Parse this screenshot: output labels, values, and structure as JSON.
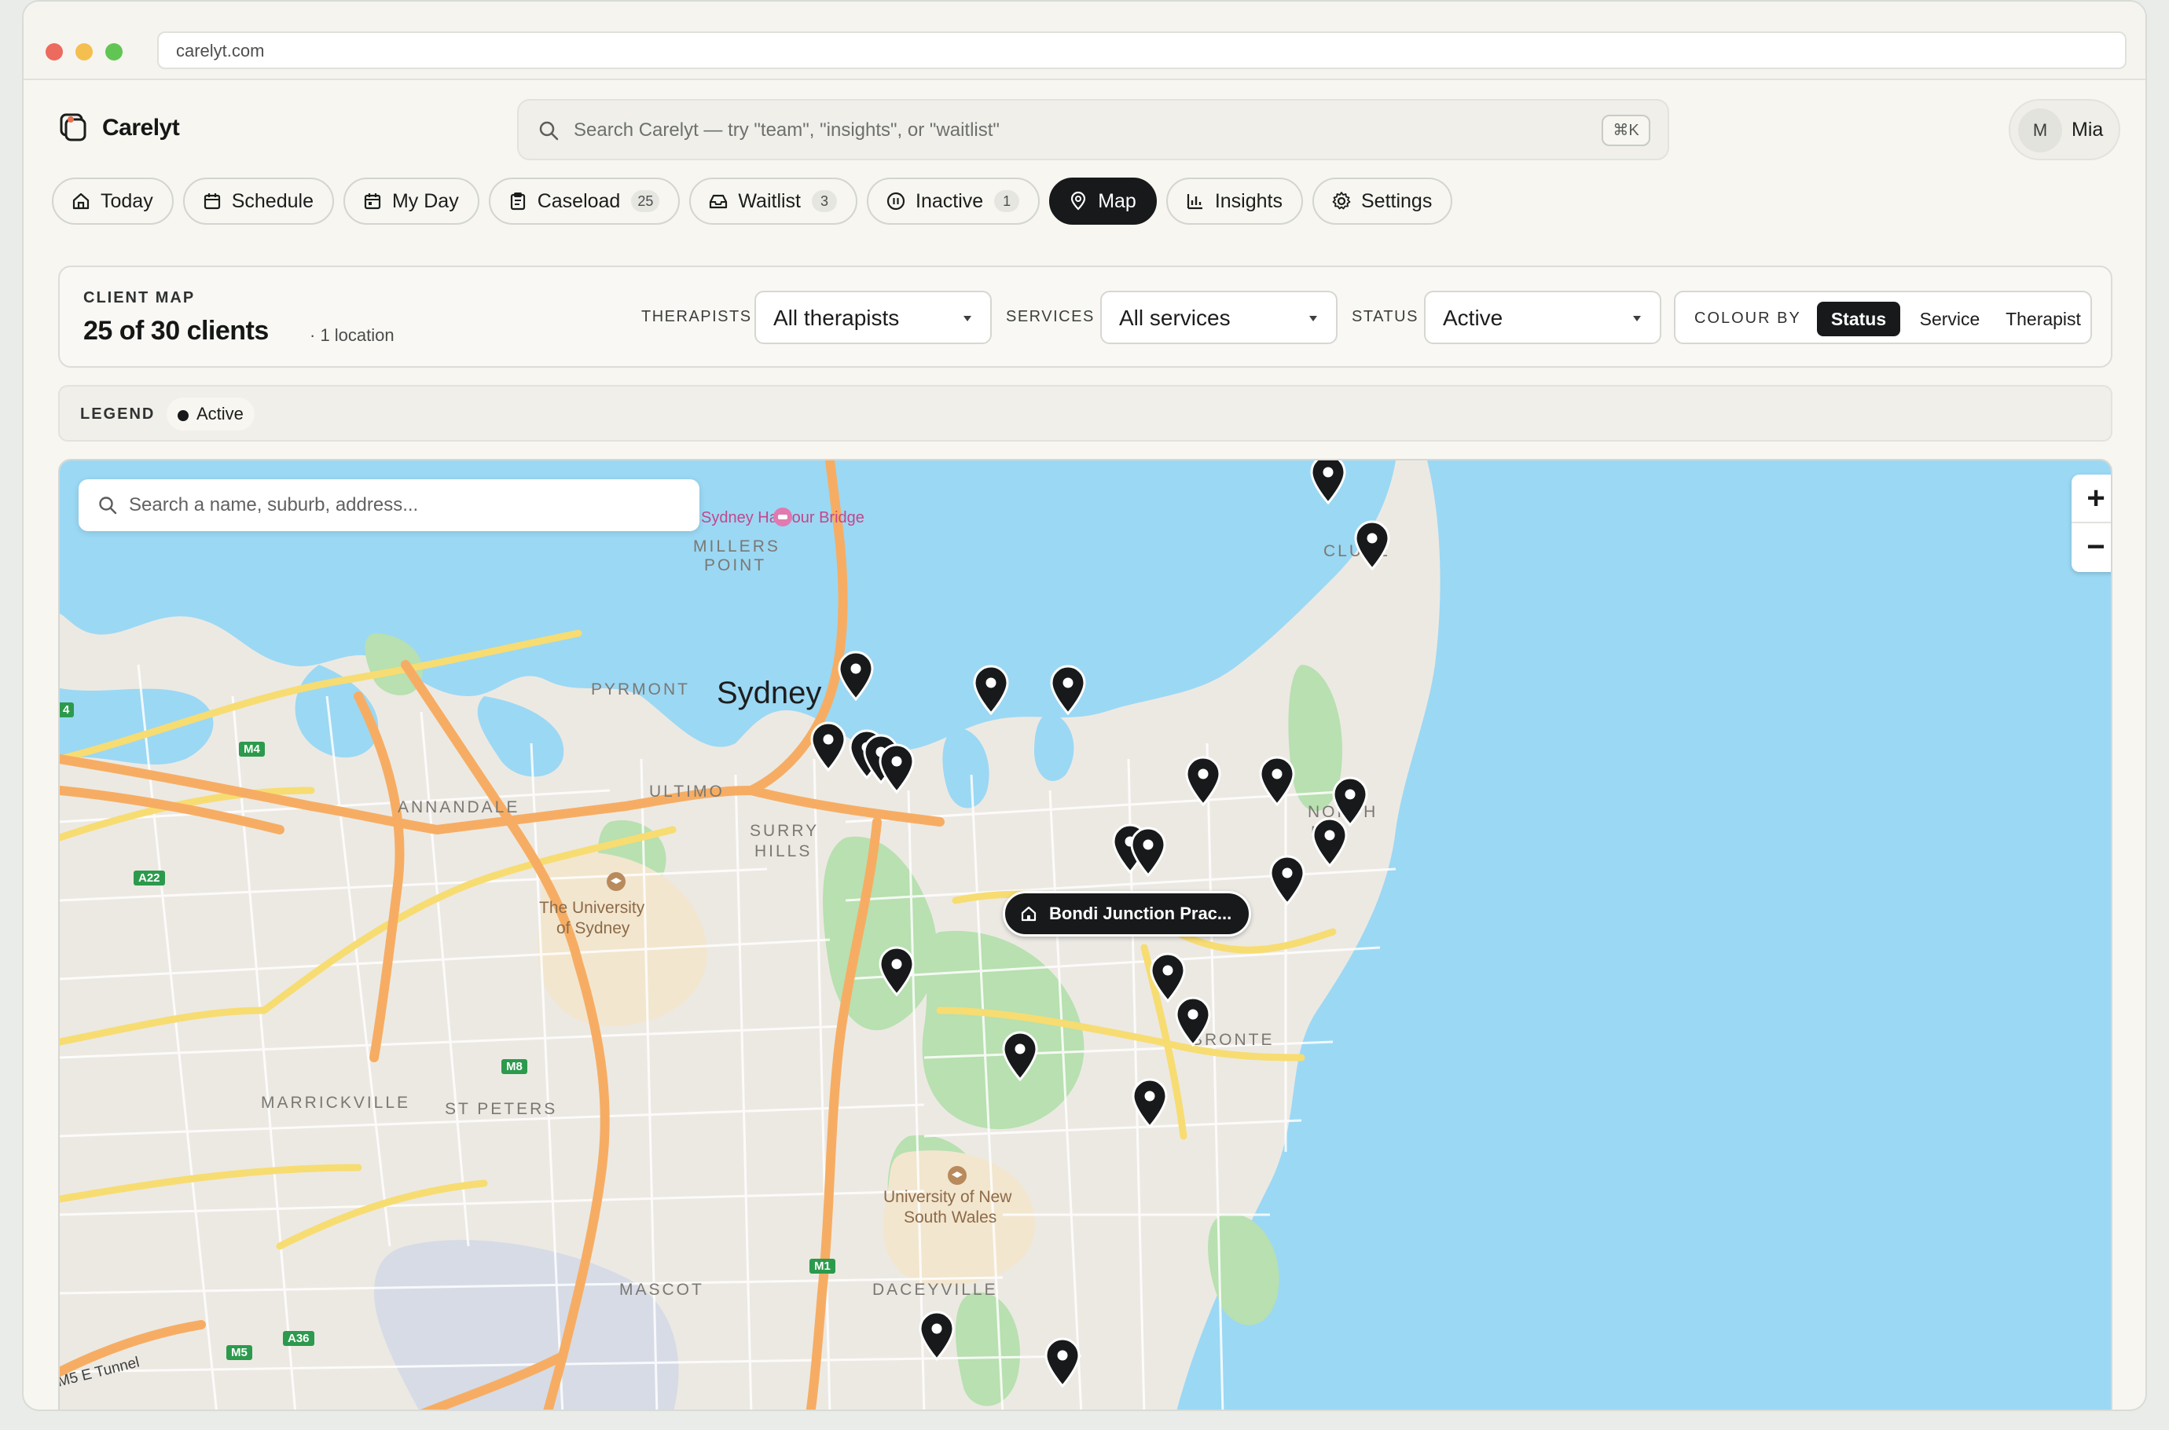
{
  "browser": {
    "url": "carelyt.com"
  },
  "app": {
    "name": "Carelyt"
  },
  "search": {
    "placeholder": "Search Carelyt — try \"team\", \"insights\", or \"waitlist\"",
    "shortcut": "⌘K"
  },
  "user": {
    "initial": "M",
    "name": "Mia"
  },
  "nav": [
    {
      "label": "Today",
      "icon": "home-icon"
    },
    {
      "label": "Schedule",
      "icon": "calendar-icon"
    },
    {
      "label": "My Day",
      "icon": "calendar-day-icon"
    },
    {
      "label": "Caseload",
      "icon": "clipboard-icon",
      "badge": "25"
    },
    {
      "label": "Waitlist",
      "icon": "inbox-icon",
      "badge": "3"
    },
    {
      "label": "Inactive",
      "icon": "pause-icon",
      "badge": "1"
    },
    {
      "label": "Map",
      "icon": "map-pin-icon",
      "active": true
    },
    {
      "label": "Insights",
      "icon": "bar-chart-icon"
    },
    {
      "label": "Settings",
      "icon": "gear-icon"
    }
  ],
  "filters": {
    "section_label": "CLIENT MAP",
    "count_text": "25 of 30 clients",
    "location_text": "· 1 location",
    "therapists": {
      "label": "THERAPISTS",
      "value": "All therapists"
    },
    "services": {
      "label": "SERVICES",
      "value": "All services"
    },
    "status": {
      "label": "STATUS",
      "value": "Active"
    },
    "colour_by": {
      "label": "COLOUR BY",
      "options": [
        "Status",
        "Service",
        "Therapist"
      ],
      "selected": "Status"
    }
  },
  "legend": {
    "label": "LEGEND",
    "items": [
      {
        "label": "Active",
        "color": "#17191a"
      }
    ]
  },
  "map": {
    "search_placeholder": "Search a name, suburb, address...",
    "zoom_in": "+",
    "zoom_out": "−",
    "practice_label": "Bondi Junction Prac...",
    "labels": {
      "sydney": "Sydney",
      "harbour_bridge": "Sydney Harbour Bridge",
      "millers_point_1": "MILLERS",
      "millers_point_2": "POINT",
      "pyrmont": "PYRMONT",
      "ultimo": "ULTIMO",
      "surry_hills_1": "SURRY",
      "surry_hills_2": "HILLS",
      "annandale": "ANNANDALE",
      "uni_sydney_1": "The University",
      "uni_sydney_2": "of Sydney",
      "marrickville": "MARRICKVILLE",
      "st_peters": "ST PETERS",
      "vaucluse": "CLUSE",
      "north_bondi_1": "NORTH",
      "north_bondi_2": "BO",
      "bronte": "BRONTE",
      "unsw_1": "University of New",
      "unsw_2": "South Wales",
      "mascot": "MASCOT",
      "daceyville": "DACEYVILLE",
      "tunnel": "M5 E Tunnel"
    },
    "shields": [
      "M4",
      "A22",
      "M8",
      "M1",
      "M5",
      "A36",
      "4"
    ],
    "colors": {
      "water": "#9bd8f4",
      "land": "#ece9e3",
      "park": "#b8e0b0",
      "major_road": "#f6ad63",
      "secondary_road": "#f7dc72",
      "pin": "#17191a"
    }
  }
}
